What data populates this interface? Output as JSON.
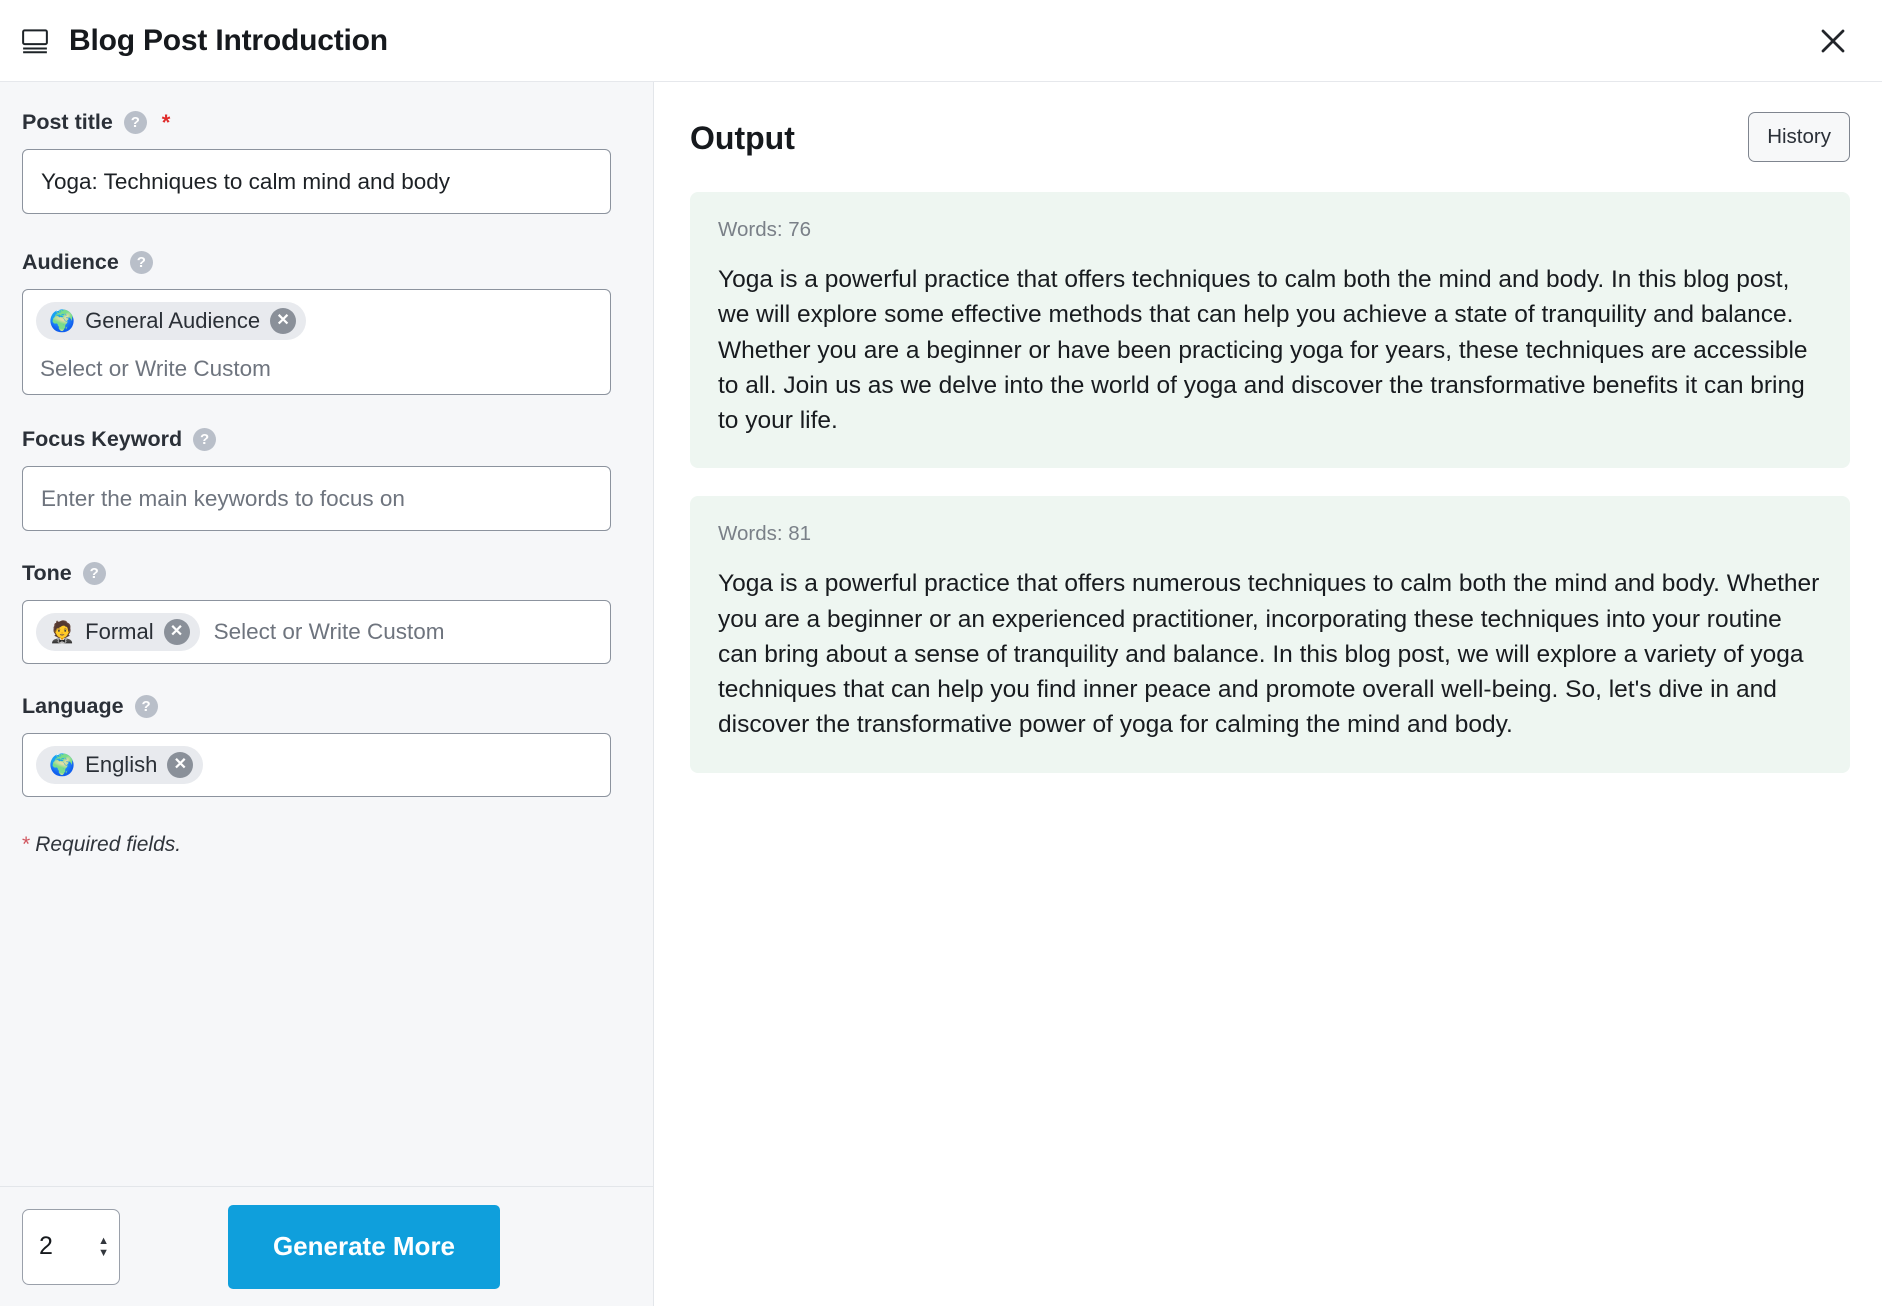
{
  "header": {
    "icon": "post-document-icon",
    "title": "Blog Post Introduction",
    "close_label": "✕"
  },
  "form": {
    "fields": {
      "post_title": {
        "label": "Post title",
        "help_icon": "?",
        "required_mark": "*",
        "value": "Yoga: Techniques to calm mind and body"
      },
      "audience": {
        "label": "Audience",
        "help_icon": "?",
        "tags": [
          {
            "emoji": "🌍",
            "label": "General Audience",
            "remove_icon": "✕"
          }
        ],
        "placeholder": "Select or Write Custom"
      },
      "focus_keyword": {
        "label": "Focus Keyword",
        "help_icon": "?",
        "value": "",
        "placeholder": "Enter the main keywords to focus on"
      },
      "tone": {
        "label": "Tone",
        "help_icon": "?",
        "tags": [
          {
            "emoji": "🤵",
            "label": "Formal",
            "remove_icon": "✕"
          }
        ],
        "placeholder": "Select or Write Custom"
      },
      "language": {
        "label": "Language",
        "help_icon": "?",
        "tags": [
          {
            "emoji": "🌍",
            "label": "English",
            "remove_icon": "✕"
          }
        ],
        "placeholder": ""
      }
    },
    "required_note_star": "*",
    "required_note_text": "Required fields.",
    "footer": {
      "count_value": "2",
      "stepper_up": "▲",
      "stepper_down": "▼",
      "generate_label": "Generate More"
    }
  },
  "output": {
    "title": "Output",
    "history_label": "History",
    "results": [
      {
        "words_label": "Words: 76",
        "text": "Yoga is a powerful practice that offers techniques to calm both the mind and body. In this blog post, we will explore some effective methods that can help you achieve a state of tranquility and balance. Whether you are a beginner or have been practicing yoga for years, these techniques are accessible to all. Join us as we delve into the world of yoga and discover the transformative benefits it can bring to your life."
      },
      {
        "words_label": "Words: 81",
        "text": "Yoga is a powerful practice that offers numerous techniques to calm both the mind and body. Whether you are a beginner or an experienced practitioner, incorporating these techniques into your routine can bring about a sense of tranquility and balance. In this blog post, we will explore a variety of yoga techniques that can help you find inner peace and promote overall well-being. So, let's dive in and discover the transformative power of yoga for calming the mind and body."
      }
    ]
  },
  "colors": {
    "accent_blue": "#0f9fdc",
    "panel_bg": "#f6f7f9",
    "card_bg": "#eef6f1",
    "required_red": "#e02b2b"
  }
}
